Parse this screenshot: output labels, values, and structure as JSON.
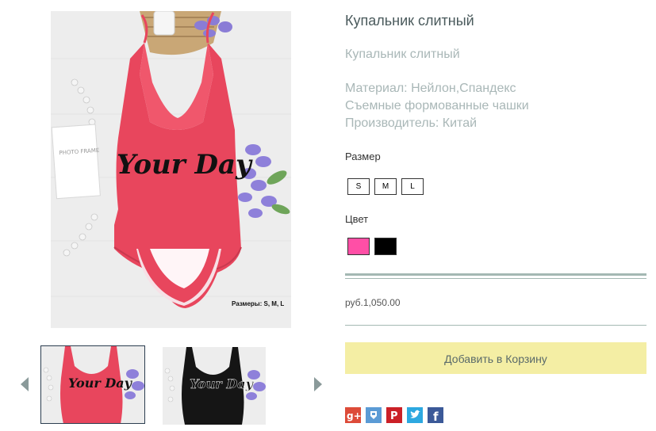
{
  "product": {
    "title": "Купальник слитный",
    "subtitle": "Купальник слитный",
    "description": [
      "Материал: Нейлон,Спандекс",
      "Съемные формованные чашки",
      "Производитель: Китай"
    ]
  },
  "gallery": {
    "brand_text": "Your Day",
    "sizes_caption": "Размеры: S, M, L",
    "frame_text": "PHOTO FRAME",
    "thumb_brand_text": "Your Day"
  },
  "options": {
    "size_label": "Размер",
    "sizes": [
      "S",
      "M",
      "L"
    ],
    "color_label": "Цвет",
    "colors": [
      "#ff4fa6",
      "#000000"
    ]
  },
  "price": "руб.1,050.00",
  "cart": {
    "add_label": "Добавить в Корзину"
  },
  "share": {
    "icons": [
      "google-plus",
      "odnoklassniki",
      "pinterest",
      "twitter",
      "facebook"
    ],
    "colors": {
      "google-plus": "#dd4b39",
      "odnoklassniki": "#5b9bd5",
      "pinterest": "#cb2027",
      "twitter": "#2da8e0",
      "facebook": "#3b5998"
    }
  },
  "colors": {
    "accent_rule": "#a3b8b3",
    "cart_button": "#f4eea4",
    "swimsuit": "#e8465d"
  }
}
